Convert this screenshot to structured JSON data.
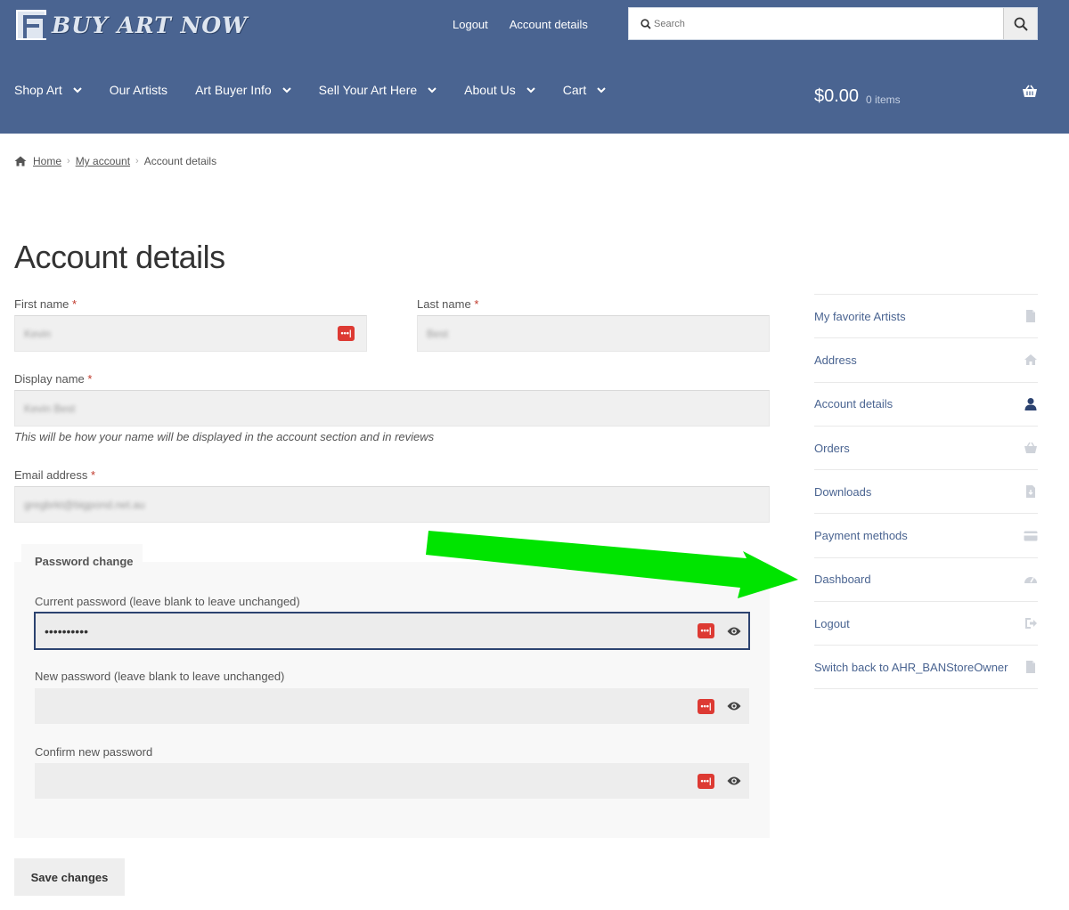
{
  "header": {
    "brand": "BUY ART NOW",
    "top_links": [
      "Logout",
      "Account details"
    ],
    "search": {
      "placeholder": "Search"
    },
    "nav": [
      {
        "label": "Shop Art",
        "dropdown": true
      },
      {
        "label": "Our Artists",
        "dropdown": false
      },
      {
        "label": "Art Buyer Info",
        "dropdown": true
      },
      {
        "label": "Sell Your Art Here",
        "dropdown": true
      },
      {
        "label": "About Us",
        "dropdown": true
      },
      {
        "label": "Cart",
        "dropdown": true
      }
    ],
    "cart": {
      "total": "$0.00",
      "items": "0 items"
    }
  },
  "breadcrumb": {
    "home": "Home",
    "account": "My account",
    "current": "Account details"
  },
  "page_title": "Account details",
  "form": {
    "first_name": {
      "label": "First name",
      "value": "Kevin"
    },
    "last_name": {
      "label": "Last name",
      "value": "Best"
    },
    "display_name": {
      "label": "Display name",
      "value": "Kevin Best",
      "hint": "This will be how your name will be displayed in the account section and in reviews"
    },
    "email": {
      "label": "Email address",
      "value": "gregbrkt@bigpond.net.au"
    },
    "required_mark": "*",
    "password_change": {
      "legend": "Password change",
      "current": {
        "label": "Current password (leave blank to leave unchanged)",
        "value": "••••••••••"
      },
      "new": {
        "label": "New password (leave blank to leave unchanged)",
        "value": ""
      },
      "confirm": {
        "label": "Confirm new password",
        "value": ""
      }
    },
    "badge_text": "•••|",
    "save_label": "Save changes"
  },
  "sidebar": {
    "items": [
      {
        "label": "My favorite Artists",
        "icon": "document-icon",
        "active": false
      },
      {
        "label": "Address",
        "icon": "home-icon",
        "active": false
      },
      {
        "label": "Account details",
        "icon": "user-icon",
        "active": true
      },
      {
        "label": "Orders",
        "icon": "basket-icon",
        "active": false
      },
      {
        "label": "Downloads",
        "icon": "file-download-icon",
        "active": false
      },
      {
        "label": "Payment methods",
        "icon": "credit-card-icon",
        "active": false
      },
      {
        "label": "Dashboard",
        "icon": "gauge-icon",
        "active": false
      },
      {
        "label": "Logout",
        "icon": "sign-out-icon",
        "active": false
      },
      {
        "label": "Switch back to AHR_BANStoreOwner",
        "icon": "document-icon",
        "active": false
      }
    ]
  },
  "colors": {
    "header_bg": "#4a6491",
    "link": "#4a6491",
    "arrow": "#00e400",
    "badge": "#dd3a33"
  }
}
